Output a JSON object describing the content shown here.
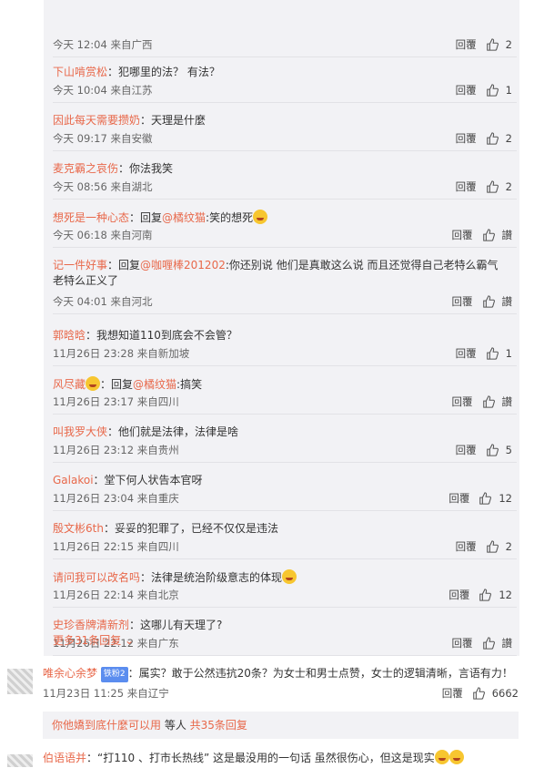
{
  "reply_label": "回覆",
  "reply_label_alt": "回覆",
  "zan_label": "讃",
  "replies": [
    {
      "nick": "",
      "text": "",
      "time": "今天 12:04 来自广西",
      "likes": "2"
    },
    {
      "nick": "下山啃赏松",
      "text": "：犯哪里的法？ 有法？",
      "time": "今天 10:04 来自江苏",
      "likes": "1"
    },
    {
      "nick": "因此每天需要攒奶",
      "text": "：天理是什麼",
      "time": "今天 09:17 来自安徽",
      "likes": "2"
    },
    {
      "nick": "麦克霸之哀伤",
      "text": "：你法我笑",
      "time": "今天 08:56 来自湖北",
      "likes": "2"
    },
    {
      "nick": "想死是一种心态",
      "text": "：回复",
      "at": "@橘纹猫",
      "text2": ":笑的想死",
      "emoji": true,
      "time": "今天 06:18 来自河南",
      "likes": "讃"
    },
    {
      "nick": "记一件好事",
      "text": "：回复",
      "at": "@咖喱棒201202",
      "text2": ":你还别说 他们是真敢这么说 而且还觉得自己老特么霸气老特么正义了",
      "time": "今天 04:01 来自河北",
      "likes": "讃"
    },
    {
      "nick": "郭晗晗",
      "text": "：我想知道110到底会不会管？",
      "time": "11月26日 23:28 来自新加坡",
      "likes": "1"
    },
    {
      "nick": "风尽藏",
      "text": "：回复",
      "at": "@橘纹猫",
      "text2": ":搞笑",
      "emoji_nick": true,
      "time": "11月26日 23:17 来自四川",
      "likes": "讃"
    },
    {
      "nick": "叫我罗大侠",
      "text": "：他们就是法律，法律是啥",
      "time": "11月26日 23:12 来自贵州",
      "likes": "5"
    },
    {
      "nick": "Galakoi",
      "text": "：堂下何人状告本官呀",
      "time": "11月26日 23:04 来自重庆",
      "likes": "12"
    },
    {
      "nick": "殷文彬6th",
      "text": "：妥妥的犯罪了，已经不仅仅是违法",
      "time": "11月26日 22:15 来自四川",
      "likes": "2"
    },
    {
      "nick": "请问我可以改名吗",
      "text": "：法律是统治阶级意志的体现",
      "emoji": true,
      "time": "11月26日 22:14 来自北京",
      "likes": "12"
    },
    {
      "nick": "史珍香牌清新剂",
      "text": "：这哪儿有天理了?",
      "time": "11月26日 22:12 来自广东",
      "likes": "讃"
    }
  ],
  "more_replies": "更多31条回复",
  "main_comment": {
    "nick": "唯余心余梦",
    "badge": "铁粉2",
    "text": "：属实？敢于公然违抗20条？为女士和男士点赞，女士的逻辑清晰，言语有力！",
    "time": "11月23日 11:25 来自辽宁",
    "likes": "6662"
  },
  "sub_summary": {
    "nick": "你他嬌到底什麼可以用",
    "text": " 等人 ",
    "link": "共35条回复"
  },
  "bottom_comment": {
    "nick": "伯语语并",
    "text": "：“打110 、打市长热线” 这是最没用的一句话 虽然很伤心，但这是现实"
  }
}
